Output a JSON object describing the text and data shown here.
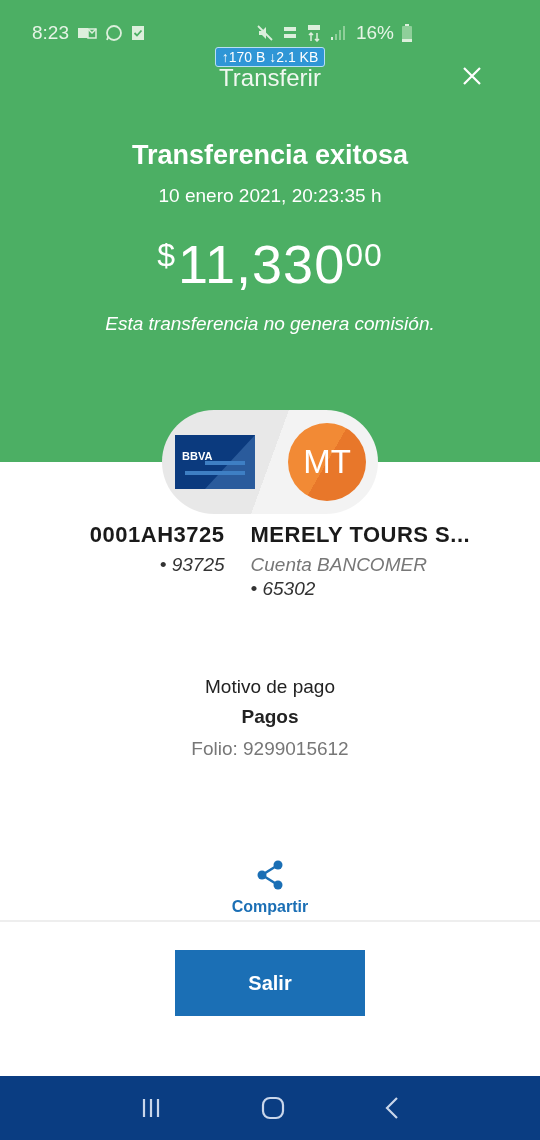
{
  "status_bar": {
    "time": "8:23",
    "battery": "16%",
    "network_speed": "↑170 B ↓2.1 KB"
  },
  "header": {
    "title": "Transferir"
  },
  "result": {
    "title": "Transferencia exitosa",
    "datetime": "10 enero 2021, 20:23:35 h",
    "currency": "$",
    "amount": "11,330",
    "cents": "00",
    "note": "Esta transferencia no genera comisión."
  },
  "origin": {
    "card_brand": "BBVA",
    "account": "0001AH3725",
    "number": "• 93725"
  },
  "destination": {
    "initials": "MT",
    "name": "MERELY TOURS S...",
    "bank": "Cuenta BANCOMER",
    "number": "• 65302"
  },
  "details": {
    "label": "Motivo de pago",
    "value": "Pagos",
    "folio": "Folio: 9299015612"
  },
  "share": {
    "label": "Compartir"
  },
  "button": {
    "label": "Salir"
  }
}
